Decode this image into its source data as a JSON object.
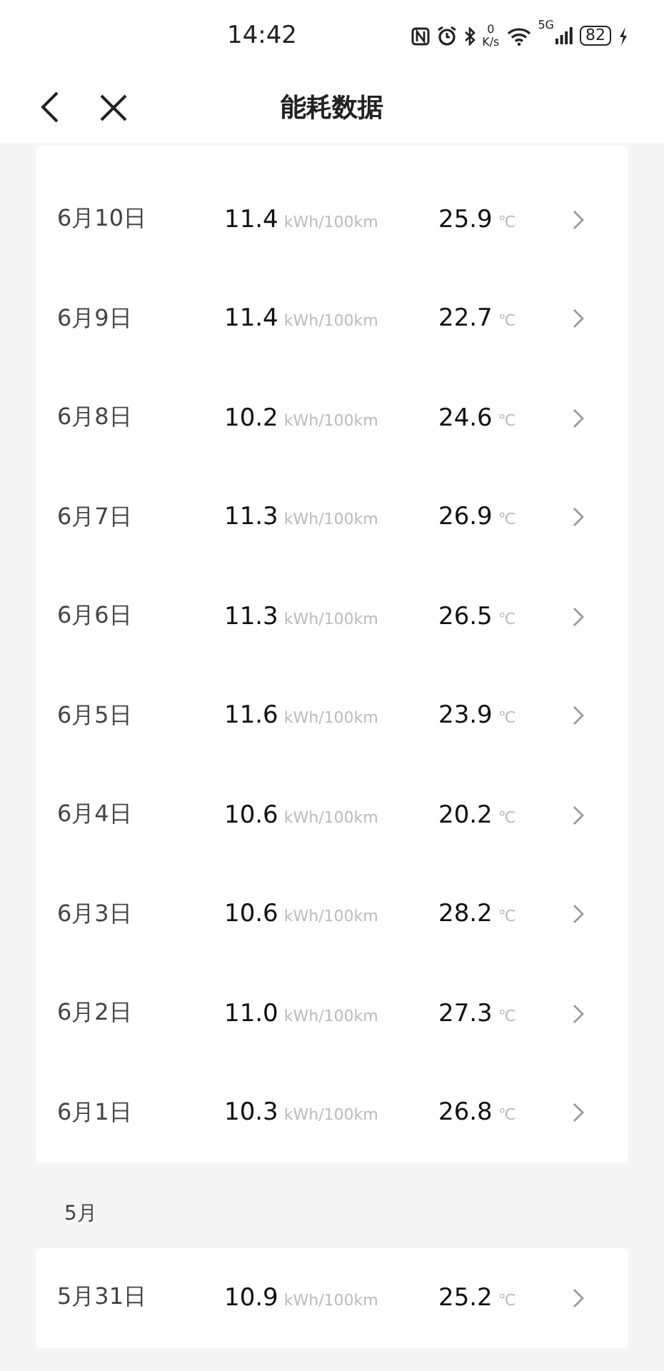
{
  "status_bar": {
    "time": "14:42",
    "net_speed_value": "0",
    "net_speed_unit": "K/s",
    "network": "5G",
    "battery": "82"
  },
  "header": {
    "title": "能耗数据"
  },
  "sections": [
    {
      "rows": [
        {
          "date": "6月10日",
          "consumption": "11.4",
          "consumption_unit": "kWh/100km",
          "temperature": "25.9",
          "temperature_unit": "℃"
        },
        {
          "date": "6月9日",
          "consumption": "11.4",
          "consumption_unit": "kWh/100km",
          "temperature": "22.7",
          "temperature_unit": "℃"
        },
        {
          "date": "6月8日",
          "consumption": "10.2",
          "consumption_unit": "kWh/100km",
          "temperature": "24.6",
          "temperature_unit": "℃"
        },
        {
          "date": "6月7日",
          "consumption": "11.3",
          "consumption_unit": "kWh/100km",
          "temperature": "26.9",
          "temperature_unit": "℃"
        },
        {
          "date": "6月6日",
          "consumption": "11.3",
          "consumption_unit": "kWh/100km",
          "temperature": "26.5",
          "temperature_unit": "℃"
        },
        {
          "date": "6月5日",
          "consumption": "11.6",
          "consumption_unit": "kWh/100km",
          "temperature": "23.9",
          "temperature_unit": "℃"
        },
        {
          "date": "6月4日",
          "consumption": "10.6",
          "consumption_unit": "kWh/100km",
          "temperature": "20.2",
          "temperature_unit": "℃"
        },
        {
          "date": "6月3日",
          "consumption": "10.6",
          "consumption_unit": "kWh/100km",
          "temperature": "28.2",
          "temperature_unit": "℃"
        },
        {
          "date": "6月2日",
          "consumption": "11.0",
          "consumption_unit": "kWh/100km",
          "temperature": "27.3",
          "temperature_unit": "℃"
        },
        {
          "date": "6月1日",
          "consumption": "10.3",
          "consumption_unit": "kWh/100km",
          "temperature": "26.8",
          "temperature_unit": "℃"
        }
      ]
    },
    {
      "month": "5月",
      "rows": [
        {
          "date": "5月31日",
          "consumption": "10.9",
          "consumption_unit": "kWh/100km",
          "temperature": "25.2",
          "temperature_unit": "℃"
        }
      ]
    }
  ]
}
